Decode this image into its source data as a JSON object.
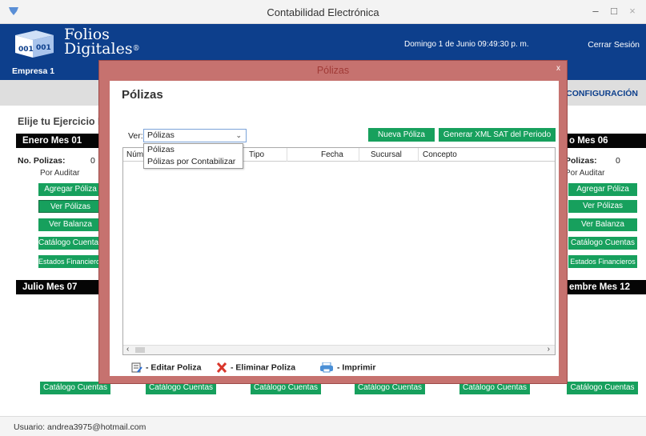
{
  "window": {
    "title": "Contabilidad Electrónica",
    "minimize_glyph": "–",
    "maximize_glyph": "□",
    "close_glyph": "×"
  },
  "header": {
    "logo_line1": "Folios",
    "logo_line2": "Digitales",
    "logo_mark": "®",
    "datetime": "Domingo 1 de Junio 09:49:30 p. m.",
    "logout": "Cerrar Sesión",
    "company": "Empresa 1"
  },
  "nav": {
    "config": "CONFIGURACIÓN"
  },
  "exercise_label": "Elije tu Ejercicio F",
  "left_panel": {
    "month_top": "Enero Mes 01",
    "policies_label": "No. Polizas:",
    "policies_count": "0",
    "audit": "Por Auditar",
    "buttons": [
      "Agregar Póliza",
      "Ver Pólizas",
      "Ver Balanza",
      "Catálogo Cuentas",
      "Estados Financieros"
    ],
    "month_bottom": "Julio Mes 07"
  },
  "right_panel": {
    "month_top": "o Mes 06",
    "policies_label": "Polizas:",
    "policies_count": "0",
    "audit": "Por Auditar",
    "buttons": [
      "Agregar Póliza",
      "Ver Pólizas",
      "Ver Balanza",
      "Catálogo Cuentas",
      "Estados Financieros"
    ],
    "month_bottom": "embre Mes 12"
  },
  "bottom_buttons": [
    "Catálogo Cuentas",
    "Catálogo Cuentas",
    "Catálogo Cuentas",
    "Catálogo Cuentas",
    "Catálogo Cuentas",
    "Catálogo Cuentas"
  ],
  "status": {
    "user": "Usuario: andrea3975@hotmail.com"
  },
  "modal": {
    "title": "Pólizas",
    "close_glyph": "x",
    "heading": "Pólizas",
    "ver_label": "Ver:",
    "ver_selected": "Pólizas",
    "ver_options": [
      "Pólizas",
      "Pólizas por Contabilizar"
    ],
    "btn_new": "Nueva Póliza",
    "btn_xml": "Generar XML SAT del Periodo",
    "columns": [
      "Núm",
      "Tipo",
      "Fecha",
      "Sucursal",
      "Concepto"
    ],
    "actions": {
      "edit": "- Editar Poliza",
      "delete": "- Eliminar Poliza",
      "print": "- Imprimir"
    }
  },
  "colors": {
    "header_blue": "#0d3f8c",
    "button_green": "#17a05d",
    "modal_frame": "#c6726f",
    "delete_red": "#d9362b"
  }
}
